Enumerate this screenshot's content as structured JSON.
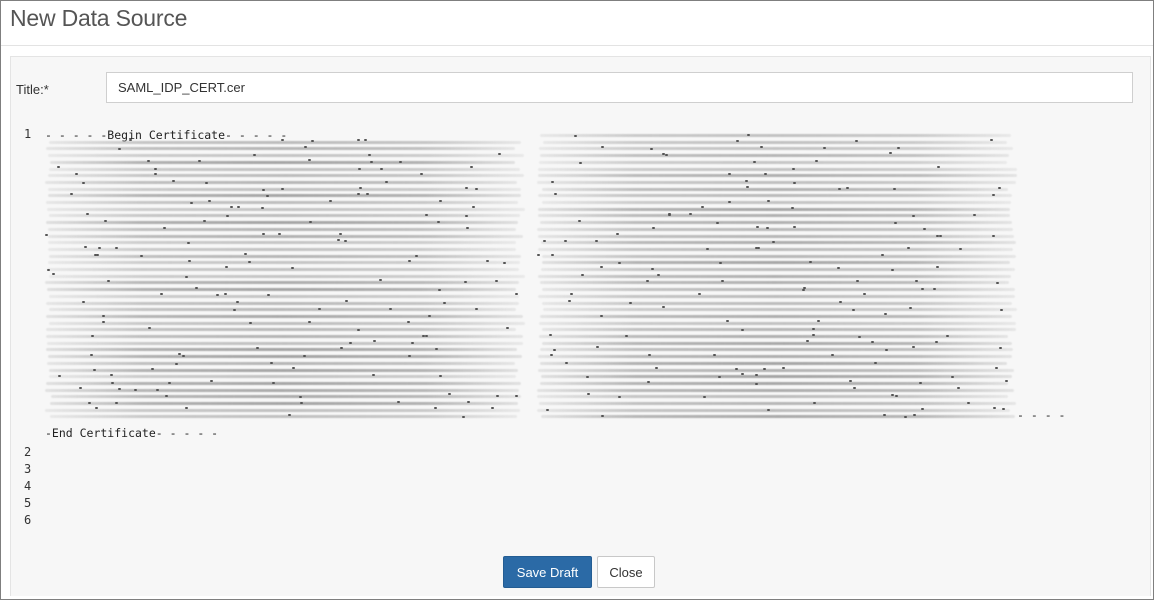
{
  "dialog": {
    "title": "New Data Source"
  },
  "form": {
    "title_label": "Title:*",
    "title_value": "SAML_IDP_CERT.cer"
  },
  "editor": {
    "line_numbers": [
      "1",
      "2",
      "3",
      "4",
      "5",
      "6"
    ],
    "begin_line": "- - - - -Begin Certificate- - - - -",
    "end_line": "-End Certificate- - - - -",
    "trailing_dashes": "- - - -"
  },
  "buttons": {
    "save_draft": "Save Draft",
    "close": "Close"
  }
}
